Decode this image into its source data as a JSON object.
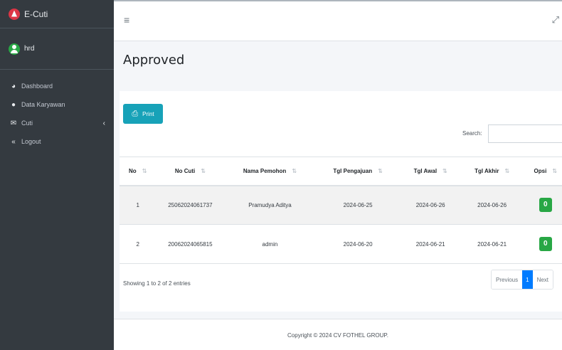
{
  "sidebar": {
    "brand": "E-Cuti",
    "user": "hrd",
    "items": [
      {
        "label": "Dashboard",
        "icon": "dashboard-icon"
      },
      {
        "label": "Data Karyawan",
        "icon": "user-icon"
      },
      {
        "label": "Cuti",
        "icon": "envelope-icon",
        "caret": "‹"
      },
      {
        "label": "Logout",
        "icon": "double-chevron-left-icon"
      }
    ]
  },
  "topbar": {
    "menu_glyph": "≡",
    "fullscreen_glyph": "⤢"
  },
  "page": {
    "title": "Approved"
  },
  "toolbar": {
    "print_label": "Print",
    "search_label": "Search:",
    "search_value": ""
  },
  "table": {
    "headers": [
      "No",
      "No Cuti",
      "Nama Pemohon",
      "Tgl Pengajuan",
      "Tgl Awal",
      "Tgl Akhir",
      "Opsi"
    ],
    "rows": [
      [
        "1",
        "25062024061737",
        "Pramudya Aditya",
        "2024-06-25",
        "2024-06-26",
        "2024-06-26",
        "0"
      ],
      [
        "2",
        "20062024065815",
        "admin",
        "2024-06-20",
        "2024-06-21",
        "2024-06-21",
        "0"
      ]
    ]
  },
  "pagination": {
    "info": "Showing 1 to 2 of 2 entries",
    "previous": "Previous",
    "current": "1",
    "next": "Next"
  },
  "footer": {
    "text": "Copyright © 2024 CV FOTHEL GROUP."
  },
  "colors": {
    "sidebar_bg": "#343a40",
    "print_button": "#17a2b8",
    "opsi_button": "#28a745",
    "page_active": "#007bff"
  }
}
